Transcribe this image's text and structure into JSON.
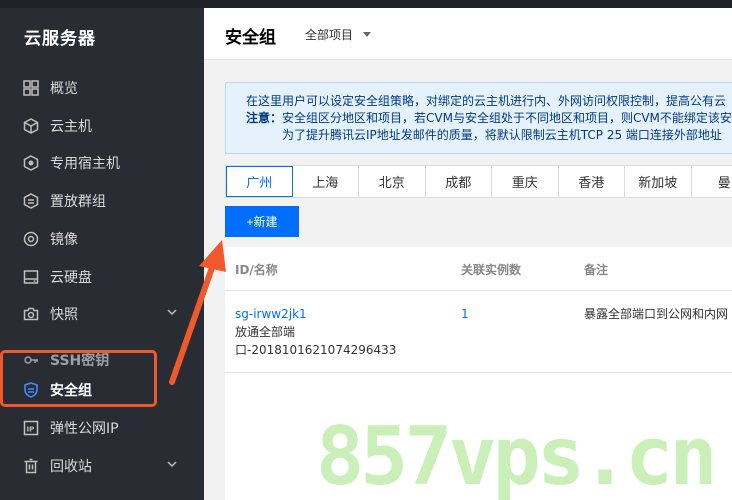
{
  "sidebar": {
    "title": "云服务器",
    "items": [
      {
        "label": "概览",
        "icon": "grid-icon"
      },
      {
        "label": "云主机",
        "icon": "cube-icon"
      },
      {
        "label": "专用宿主机",
        "icon": "host-icon"
      },
      {
        "label": "置放群组",
        "icon": "placement-icon"
      },
      {
        "label": "镜像",
        "icon": "disc-icon"
      },
      {
        "label": "云硬盘",
        "icon": "harddisk-icon"
      },
      {
        "label": "快照",
        "icon": "camera-icon"
      },
      {
        "label": "SSH密钥",
        "icon": "key-icon"
      },
      {
        "label": "安全组",
        "icon": "shield-icon"
      },
      {
        "label": "弹性公网IP",
        "icon": "ip-icon"
      },
      {
        "label": "回收站",
        "icon": "trash-icon"
      }
    ]
  },
  "header": {
    "title": "安全组",
    "project_select": "全部项目"
  },
  "notice": {
    "line1": "在这里用户可以设定安全组策略，对绑定的云主机进行内、外网访问权限控制，提高公有云",
    "line2_prefix": "注意：",
    "line2": "安全组区分地区和项目，若CVM与安全组处于不同地区和项目，则CVM不能绑定该安",
    "line3": "为了提升腾讯云IP地址发邮件的质量，将默认限制云主机TCP 25 端口连接外部地址"
  },
  "regions": [
    "广州",
    "上海",
    "北京",
    "成都",
    "重庆",
    "香港",
    "新加坡",
    "曼"
  ],
  "active_region": "广州",
  "new_button": "+新建",
  "table": {
    "columns": [
      "ID/名称",
      "关联实例数",
      "备注"
    ],
    "rows": [
      {
        "id": "sg-irww2jk1",
        "name_line1": "放通全部端",
        "name_line2": "口-2018101621074296433",
        "instances": "1",
        "note": "暴露全部端口到公网和内网"
      }
    ]
  },
  "watermark": "857vps.cn",
  "colors": {
    "accent": "#006eff",
    "sidebar_bg": "#292d33",
    "annotation": "#f0592b"
  }
}
